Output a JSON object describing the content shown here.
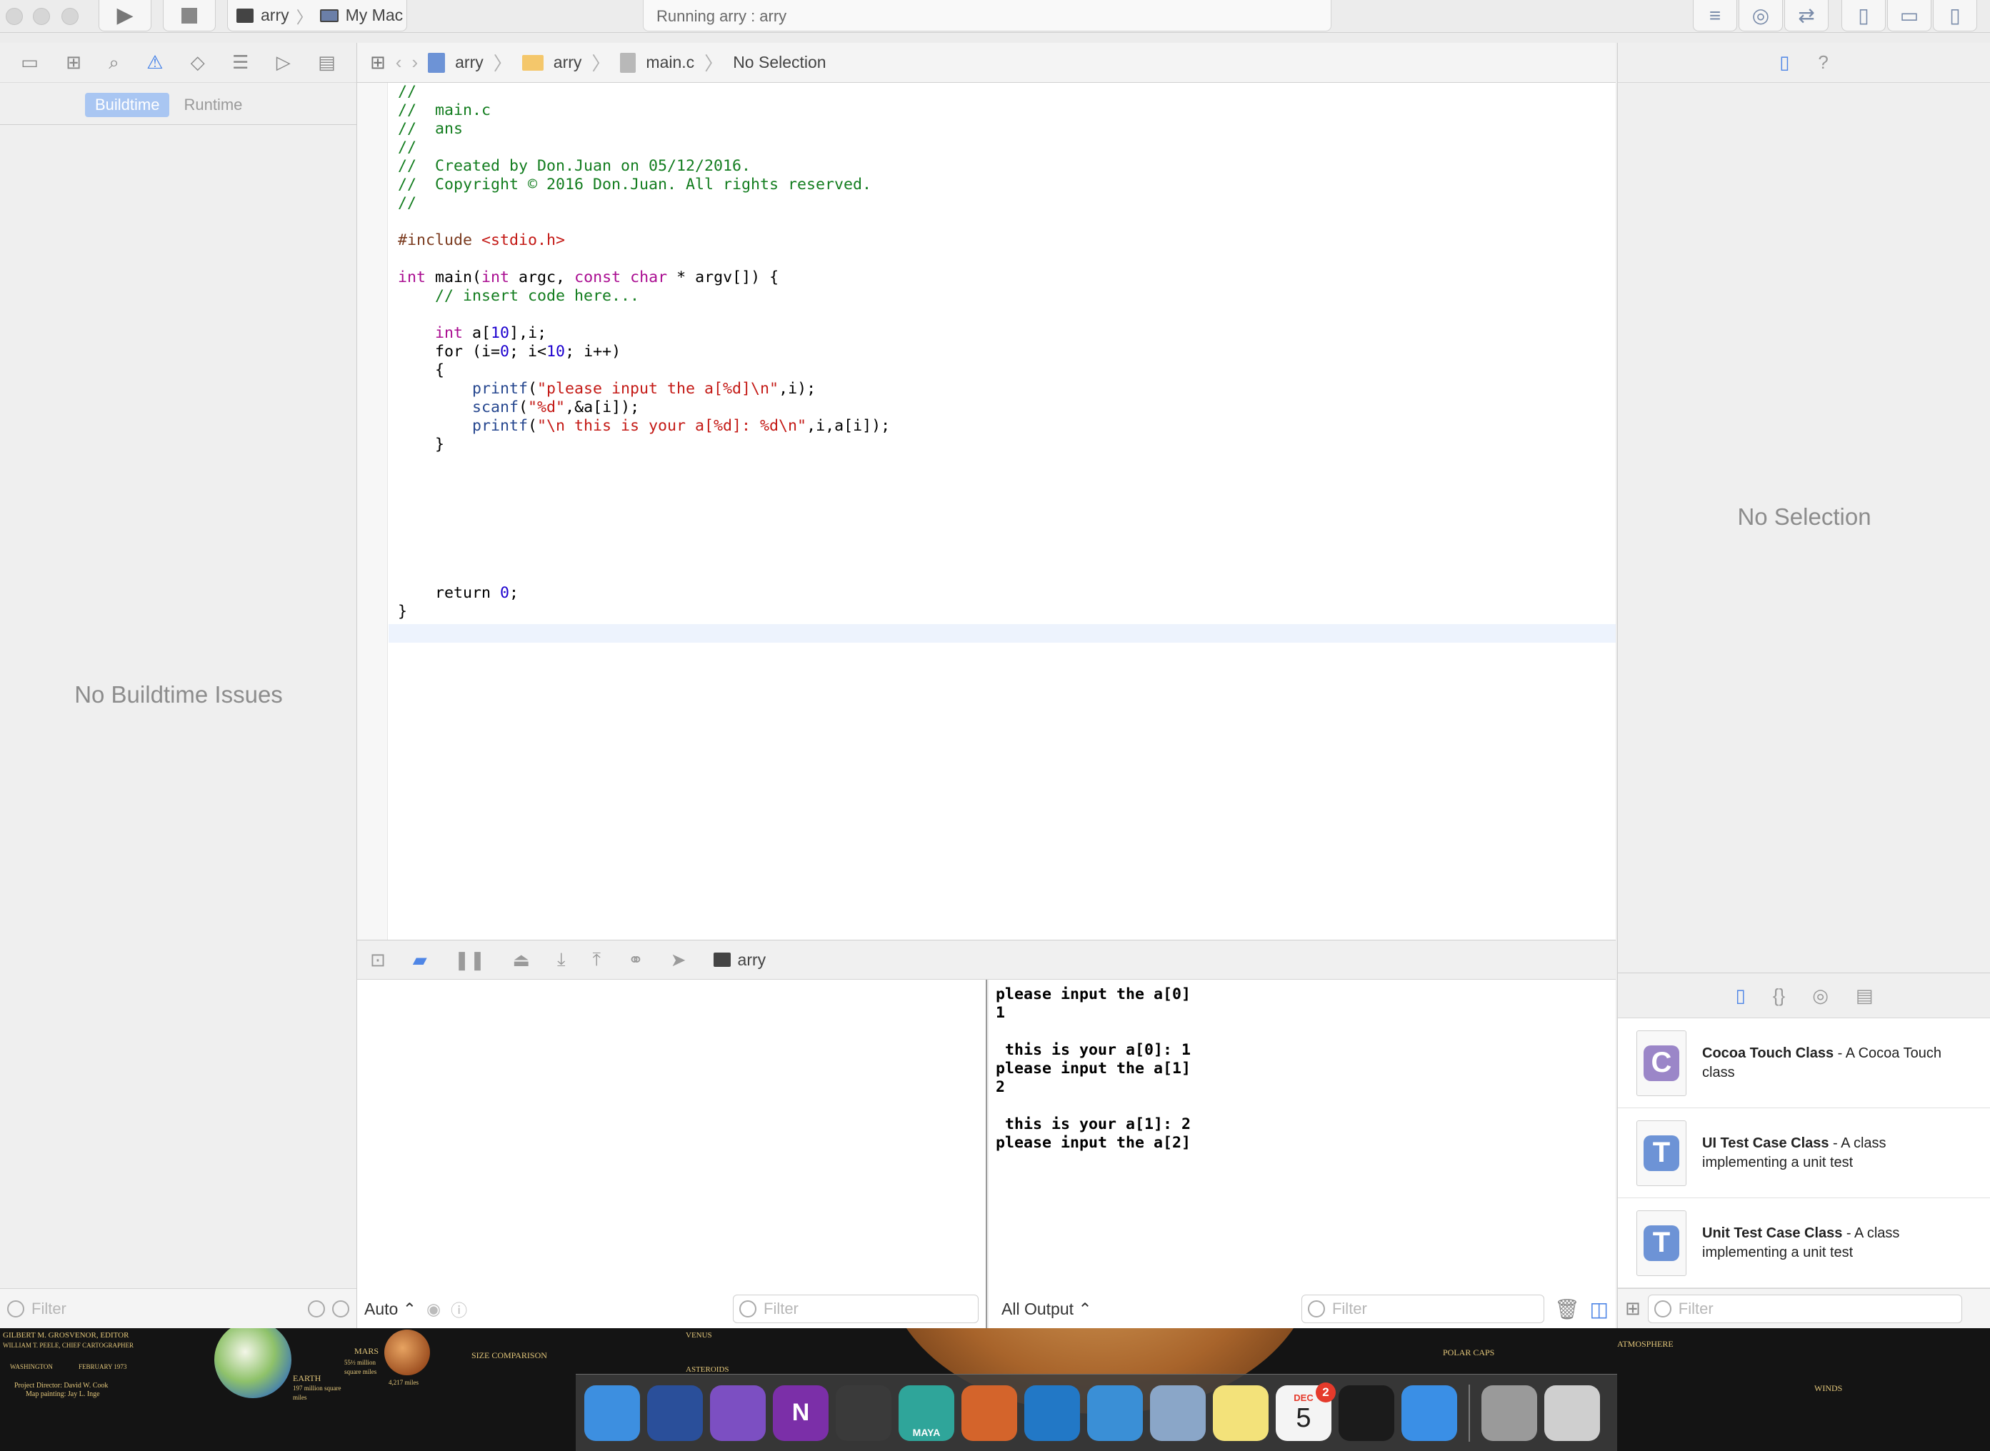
{
  "toolbar": {
    "scheme_target": "arry",
    "scheme_device": "My Mac",
    "activity_status": "Running arry : arry"
  },
  "navigator": {
    "segments": [
      "Buildtime",
      "Runtime"
    ],
    "selected_segment": "Buildtime",
    "empty_message": "No Buildtime Issues",
    "filter_placeholder": "Filter"
  },
  "jumpbar": {
    "crumbs": [
      "arry",
      "arry",
      "main.c",
      "No Selection"
    ]
  },
  "editor": {
    "lines": [
      "//",
      "//  main.c",
      "//  ans",
      "//",
      "//  Created by Don.Juan on 05/12/2016.",
      "//  Copyright © 2016 Don.Juan. All rights reserved.",
      "//",
      "",
      "#include <stdio.h>",
      "",
      "int main(int argc, const char * argv[]) {",
      "    // insert code here...",
      "",
      "    int a[10],i;",
      "    for (i=0; i<10; i++)",
      "    {",
      "        printf(\"please input the a[%d]\\n\",i);",
      "        scanf(\"%d\",&a[i]);",
      "        printf(\"\\n this is your a[%d]: %d\\n\",i,a[i]);",
      "    }",
      "",
      "",
      "",
      "",
      "",
      "",
      "",
      "    return 0;",
      "}"
    ]
  },
  "debug": {
    "process_name": "arry",
    "console_lines": [
      "please input the a[0]",
      "1",
      "",
      " this is your a[0]: 1",
      "please input the a[1]",
      "2",
      "",
      " this is your a[1]: 2",
      "please input the a[2]"
    ],
    "variables_scope": "Auto ⌃",
    "output_scope": "All Output ⌃",
    "filter_placeholder": "Filter"
  },
  "inspector": {
    "empty_message": "No Selection",
    "library_items": [
      {
        "icon_letter": "C",
        "icon_color": "#9b86c8",
        "title": "Cocoa Touch Class",
        "desc": " - A Cocoa Touch class"
      },
      {
        "icon_letter": "T",
        "icon_color": "#6d93d6",
        "title": "UI Test Case Class",
        "desc": " - A class implementing a unit test"
      },
      {
        "icon_letter": "T",
        "icon_color": "#6d93d6",
        "title": "Unit Test Case Class",
        "desc": " - A class implementing a unit test"
      }
    ],
    "filter_placeholder": "Filter"
  },
  "desktop": {
    "map_texts": [
      "GILBERT M. GROSVENOR, EDITOR",
      "WILLIAM T. PEELE, CHIEF CARTOGRAPHER",
      "WASHINGTON",
      "FEBRUARY 1973",
      "Project Director: David W. Cook",
      "Map painting: Jay L. Inge",
      "EARTH",
      "197 million square miles",
      "MARS",
      "55½ million square miles",
      "4,217 miles",
      "SIZE COMPARISON",
      "VENUS",
      "ASTEROIDS",
      "POLAR CAPS",
      "ATMOSPHERE",
      "WINDS"
    ]
  },
  "dock": {
    "apps": [
      {
        "name": "finder",
        "color": "#3d8fe0",
        "label": ""
      },
      {
        "name": "launchpad",
        "color": "#2a4f9a",
        "label": ""
      },
      {
        "name": "visual-studio",
        "color": "#7c4fc2",
        "label": ""
      },
      {
        "name": "onenote",
        "color": "#7b2fa8",
        "label": "N"
      },
      {
        "name": "atom",
        "color": "#3a3a3a",
        "label": ""
      },
      {
        "name": "maya",
        "color": "#2fa59a",
        "label": "MAYA"
      },
      {
        "name": "matlab",
        "color": "#d4642b",
        "label": ""
      },
      {
        "name": "vscode",
        "color": "#2278c6",
        "label": ""
      },
      {
        "name": "xcode",
        "color": "#3a8fd6",
        "label": ""
      },
      {
        "name": "remote-desktop",
        "color": "#8aa6c8",
        "label": ""
      },
      {
        "name": "stickies",
        "color": "#f3e27a",
        "label": ""
      },
      {
        "name": "calendar",
        "color": "#f4f4f4",
        "label": "5",
        "month": "DEC",
        "badge": "2"
      },
      {
        "name": "qq",
        "color": "#1b1b1b",
        "label": ""
      },
      {
        "name": "safari",
        "color": "#3a8fe6",
        "label": ""
      },
      {
        "name": "disk-utility",
        "color": "#9a9a9a",
        "label": ""
      },
      {
        "name": "trash",
        "color": "#cfcfcf",
        "label": ""
      }
    ]
  }
}
